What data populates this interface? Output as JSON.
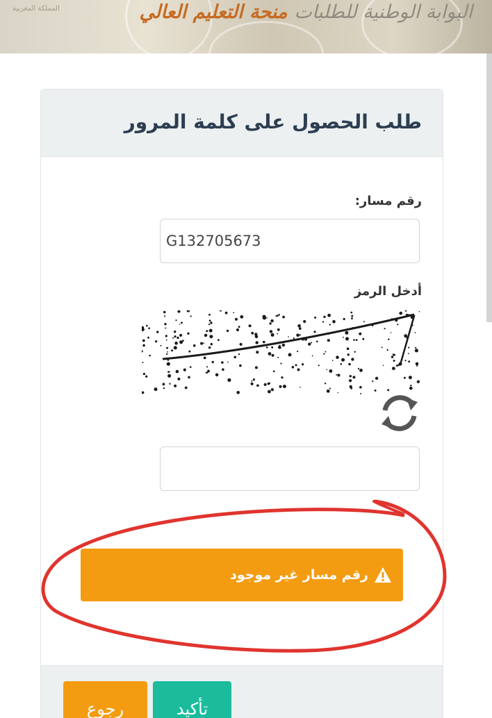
{
  "banner": {
    "portal_text": "البوابة الوطنية للطلبات",
    "grant_text": "منحة التعليم العالي",
    "kingdom_text": "المملكة المغربية"
  },
  "form": {
    "title": "طلب الحصول على كلمة المرور",
    "massar_label": "رقم مسار:",
    "massar_value": "G132705673",
    "captcha_label": "أدخل الرمز",
    "captcha_text": "PCG2",
    "captcha_input_value": ""
  },
  "alert": {
    "message": "رقم مسار غير موجود",
    "icon": "warning-icon",
    "color": "#f39c12"
  },
  "buttons": {
    "back_label": "رجوع",
    "confirm_label": "تأكيد",
    "back_color": "#f39c12",
    "confirm_color": "#1abc9c"
  },
  "annotation": {
    "type": "red-hand-drawn-circle",
    "color": "#e0342e"
  }
}
